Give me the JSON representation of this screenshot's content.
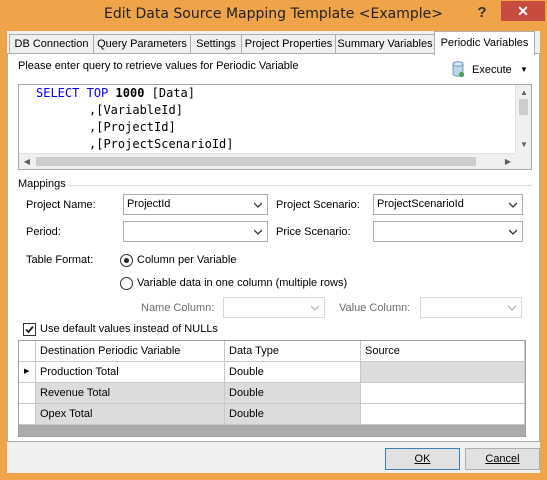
{
  "window": {
    "title": "Edit Data Source Mapping Template <Example>",
    "help_glyph": "?",
    "close_glyph": "✕"
  },
  "tabs": [
    {
      "label": "DB Connection"
    },
    {
      "label": "Query Parameters"
    },
    {
      "label": "Settings"
    },
    {
      "label": "Project Properties"
    },
    {
      "label": "Summary Variables"
    },
    {
      "label": "Periodic Variables",
      "active": true
    }
  ],
  "panel": {
    "instruction": "Please enter query to retrieve values for Periodic Variable",
    "execute_label": "Execute",
    "sql": {
      "line1_kw1": "SELECT",
      "line1_kw2": "TOP",
      "line1_num": "1000",
      "line1_rest": "[Data]",
      "line2": ",[VariableId]",
      "line3": ",[ProjectId]",
      "line4": ",[ProjectScenarioId]"
    }
  },
  "mappings": {
    "group_title": "Mappings",
    "project_name_label": "Project Name:",
    "project_name_value": "ProjectId",
    "project_scenario_label": "Project Scenario:",
    "project_scenario_value": "ProjectScenarioId",
    "period_label": "Period:",
    "period_value": "",
    "price_scenario_label": "Price Scenario:",
    "price_scenario_value": "",
    "table_format_label": "Table Format:",
    "radio_column_per_variable": "Column per Variable",
    "radio_one_column": "Variable data in one column (multiple rows)",
    "name_column_label": "Name Column:",
    "value_column_label": "Value Column:",
    "use_default_label": "Use default values instead of NULLs",
    "table_format_selected": "Column per Variable",
    "use_default_checked": true
  },
  "grid": {
    "columns": [
      "Destination Periodic Variable",
      "Data Type",
      "Source"
    ],
    "rows": [
      [
        "Production Total",
        "Double",
        ""
      ],
      [
        "Revenue Total",
        "Double",
        ""
      ],
      [
        "Opex Total",
        "Double",
        ""
      ]
    ],
    "current_row_glyph": "▶"
  },
  "footer": {
    "ok_label": "OK",
    "cancel_label": "Cancel"
  },
  "colors": {
    "title_bar": "#f0a44a",
    "close_button": "#c74b3f",
    "sql_keyword": "#0000ff"
  }
}
